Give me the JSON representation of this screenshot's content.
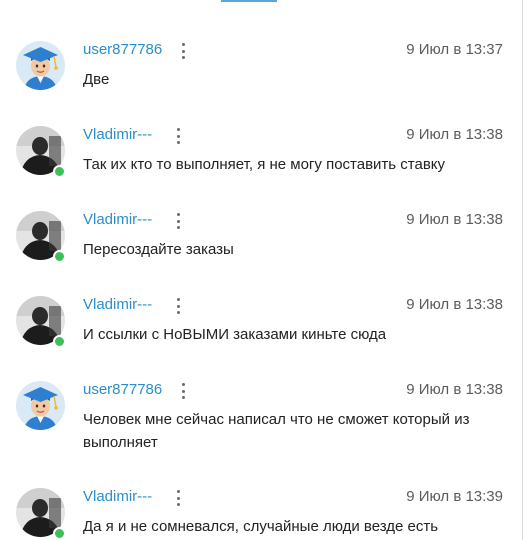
{
  "messages": [
    {
      "user": "user877786",
      "time": "9 Июл в 13:37",
      "text": "Две"
    },
    {
      "user": "Vladimir---",
      "time": "9 Июл в 13:38",
      "text": "Так их кто то выполняет, я не могу поставить ставку"
    },
    {
      "user": "Vladimir---",
      "time": "9 Июл в 13:38",
      "text": "Пересоздайте заказы"
    },
    {
      "user": "Vladimir---",
      "time": "9 Июл в 13:38",
      "text": "И ссылки с НоВЫМИ заказами киньте сюда"
    },
    {
      "user": "user877786",
      "time": "9 Июл в 13:38",
      "text": "Человек мне сейчас написал что не сможет который из выполняет"
    },
    {
      "user": "Vladimir---",
      "time": "9 Июл в 13:39",
      "text": "Да я и не сомневался, случайные люди везде есть"
    }
  ],
  "colors": {
    "username": "#2a8fc9",
    "online": "#3cc15a",
    "text": "#222222",
    "timestamp": "#5c5c5c"
  },
  "icons": {
    "menu": "kebab-menu-icon",
    "online": "online-status-icon"
  }
}
